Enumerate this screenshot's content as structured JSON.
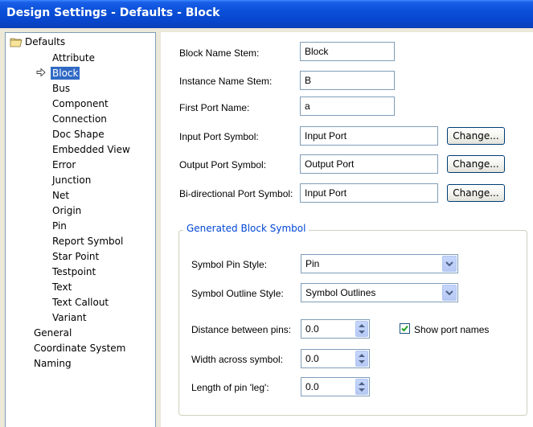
{
  "window": {
    "title": "Design Settings - Defaults - Block"
  },
  "tree": {
    "root": "Defaults",
    "children": [
      "Attribute",
      "Block",
      "Bus",
      "Component",
      "Connection",
      "Doc Shape",
      "Embedded View",
      "Error",
      "Junction",
      "Net",
      "Origin",
      "Pin",
      "Report Symbol",
      "Star Point",
      "Testpoint",
      "Text",
      "Text Callout",
      "Variant"
    ],
    "selected": "Block",
    "top_level": [
      "General",
      "Coordinate System",
      "Naming"
    ]
  },
  "form": {
    "block_name_stem": {
      "label": "Block Name Stem:",
      "value": "Block"
    },
    "instance_name_stem": {
      "label": "Instance Name Stem:",
      "value": "B"
    },
    "first_port_name": {
      "label": "First Port Name:",
      "value": "a"
    },
    "input_port_symbol": {
      "label": "Input Port Symbol:",
      "value": "Input Port",
      "button": "Change..."
    },
    "output_port_symbol": {
      "label": "Output Port Symbol:",
      "value": "Output Port",
      "button": "Change..."
    },
    "bidir_port_symbol": {
      "label": "Bi-directional Port Symbol:",
      "value": "Input Port",
      "button": "Change..."
    }
  },
  "generated": {
    "title": "Generated Block Symbol",
    "pin_style": {
      "label": "Symbol Pin Style:",
      "value": "Pin"
    },
    "outline_style": {
      "label": "Symbol Outline Style:",
      "value": "Symbol Outlines"
    },
    "distance_between_pins": {
      "label": "Distance between pins:",
      "value": "0.0"
    },
    "width_across_symbol": {
      "label": "Width across symbol:",
      "value": "0.0"
    },
    "length_of_pin_leg": {
      "label": "Length of pin 'leg':",
      "value": "0.0"
    },
    "show_port_names": {
      "label": "Show port names",
      "checked": true
    }
  },
  "colors": {
    "title_bar": "#0a4fd8",
    "selection": "#316ac5",
    "group_title": "#0046d5"
  }
}
